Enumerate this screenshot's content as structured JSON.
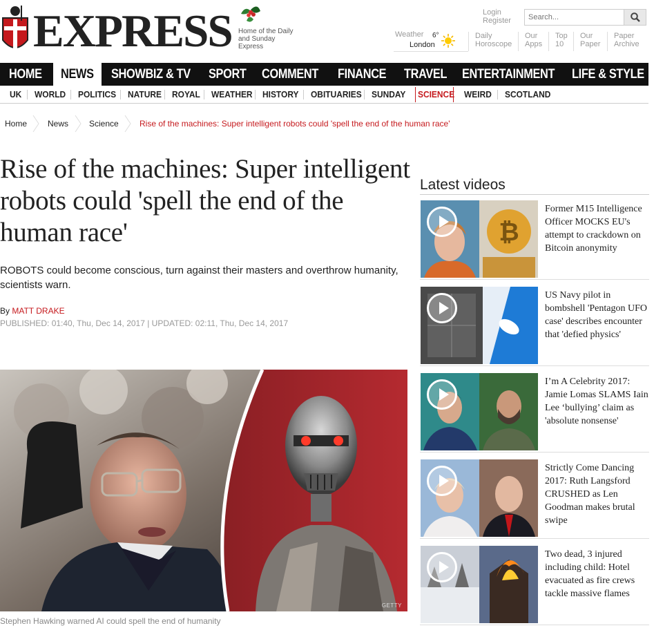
{
  "header": {
    "logo_text": "EXPRESS",
    "tagline": "Home of the Daily and Sunday Express",
    "login": "Login",
    "register": "Register",
    "search_placeholder": "Search...",
    "weather_label": "Weather",
    "weather_temp": "6°",
    "weather_city": "London",
    "links": [
      {
        "l1": "Daily",
        "l2": "Horoscope"
      },
      {
        "l1": "Our",
        "l2": "Apps"
      },
      {
        "l1": "Top",
        "l2": "10"
      },
      {
        "l1": "Our",
        "l2": "Paper"
      },
      {
        "l1": "Paper",
        "l2": "Archive"
      }
    ]
  },
  "nav_primary": [
    "HOME",
    "NEWS",
    "SHOWBIZ & TV",
    "SPORT",
    "COMMENT",
    "FINANCE",
    "TRAVEL",
    "ENTERTAINMENT",
    "LIFE & STYLE"
  ],
  "nav_primary_active": "NEWS",
  "nav_secondary": [
    "UK",
    "WORLD",
    "POLITICS",
    "NATURE",
    "ROYAL",
    "WEATHER",
    "HISTORY",
    "OBITUARIES",
    "SUNDAY",
    "SCIENCE",
    "WEIRD",
    "SCOTLAND"
  ],
  "nav_secondary_active": "SCIENCE",
  "breadcrumb": [
    "Home",
    "News",
    "Science",
    "Rise of the machines: Super intelligent robots could 'spell the end of the human race'"
  ],
  "article": {
    "headline": "Rise of the machines: Super intelligent robots could 'spell the end of the human race'",
    "standfirst": "ROBOTS could become conscious, turn against their masters and overthrow humanity, scientists warn.",
    "by_label": "By",
    "author": "MATT DRAKE",
    "published": "PUBLISHED: 01:40, Thu, Dec 14, 2017 | UPDATED: 02:11, Thu, Dec 14, 2017",
    "image_credit": "GETTY",
    "caption": "Stephen Hawking warned AI could spell the end of humanity"
  },
  "latest_videos": {
    "title": "Latest videos",
    "items": [
      {
        "title": "Former M15 Intelligence Officer MOCKS EU's attempt to crackdown on Bitcoin anonymity"
      },
      {
        "title": "US Navy pilot in bombshell 'Pentagon UFO case' describes encounter that 'defied physics'"
      },
      {
        "title": "I’m A Celebrity 2017: Jamie Lomas SLAMS Iain Lee ‘bullying’ claim as 'absolute nonsense'"
      },
      {
        "title": "Strictly Come Dancing 2017: Ruth Langsford CRUSHED as Len Goodman makes brutal swipe"
      },
      {
        "title": "Two dead, 3 injured including child: Hotel evacuated as fire crews tackle massive flames"
      }
    ]
  },
  "colors": {
    "brand_red": "#c5191d",
    "nav_bg": "#111111"
  }
}
